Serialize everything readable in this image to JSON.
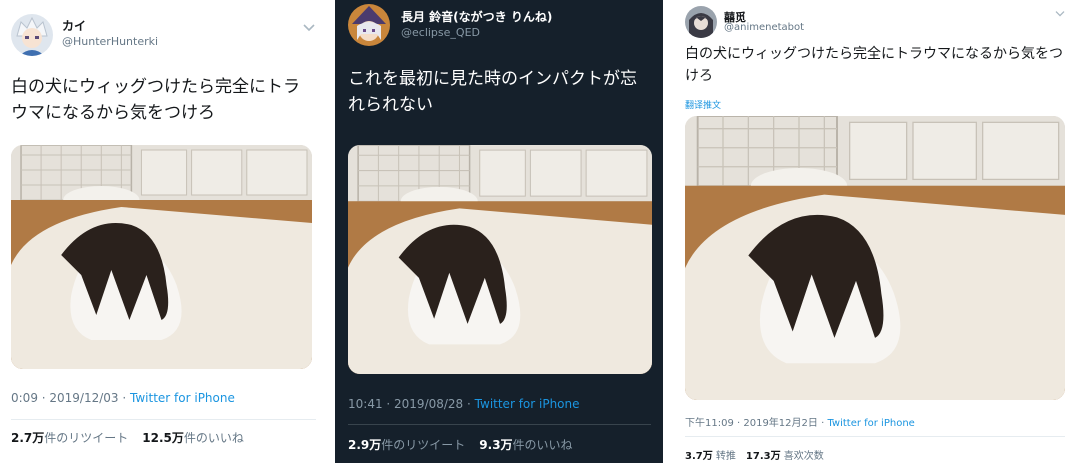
{
  "colors": {
    "link": "#1b95e0",
    "dark_background": "#15202b",
    "light_text": "#14171a",
    "dark_text": "#ffffff",
    "muted_light": "#657786",
    "muted_dark": "#8899a6"
  },
  "tweets": [
    {
      "display_name": "カイ",
      "handle": "@HunterHunterki",
      "avatar_icon": "avatar-white-hair-character",
      "text": "白の犬にウィッグつけたら完全にトラウマになるから気をつけろ",
      "time": "0:09 · 2019/12/03",
      "source": "Twitter for iPhone",
      "retweets": {
        "count": "2.7万",
        "label": "件のリツイート"
      },
      "likes": {
        "count": "12.5万",
        "label": "件のいいね"
      },
      "image_alt": "長い黒髪のウィッグを付けた白い犬"
    },
    {
      "display_name": "長月 鈴音(ながつき りんね)",
      "handle": "@eclipse_QED",
      "avatar_icon": "avatar-witch-hat-character",
      "text": "これを最初に見た時のインパクトが忘れられない",
      "time": "10:41 · 2019/08/28",
      "source": "Twitter for iPhone",
      "retweets": {
        "count": "2.9万",
        "label": "件のリツイート"
      },
      "likes": {
        "count": "9.3万",
        "label": "件のいいね"
      },
      "image_alt": "長い黒髪のウィッグを付けた白い犬"
    },
    {
      "display_name": "囍觅",
      "handle": "@animenetabot",
      "avatar_icon": "avatar-dark-hair-character",
      "text": "白の犬にウィッグつけたら完全にトラウマになるから気をつけろ",
      "translate": "翻译推文",
      "time": "下午11:09 · 2019年12月2日",
      "source": "Twitter for iPhone",
      "retweets": {
        "count": "3.7万",
        "label": "转推"
      },
      "likes": {
        "count": "17.3万",
        "label": "喜欢次数"
      },
      "image_alt": "长黑假发的白狗"
    }
  ]
}
